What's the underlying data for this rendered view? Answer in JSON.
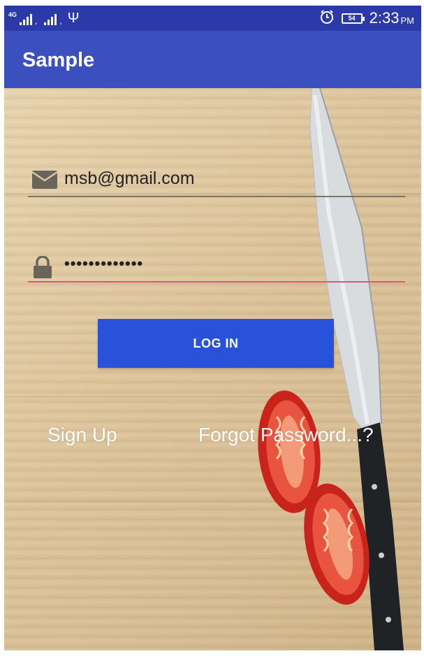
{
  "status_bar": {
    "network_type": "4G",
    "time": "2:33",
    "am_pm": "PM",
    "battery_level": "54",
    "icons": [
      "signal-icon",
      "signal-icon",
      "usb-icon",
      "alarm-icon",
      "battery-icon"
    ]
  },
  "app_bar": {
    "title": "Sample",
    "color": "#3c4fbe"
  },
  "login_form": {
    "email_value": "msb@gmail.com",
    "password_value": "•••••••••••••",
    "login_label": "LOG IN",
    "signup_label": "Sign Up",
    "forgot_label": "Forgot Password...?",
    "accent_color": "#2852d9",
    "focus_underline_color": "#e0567b",
    "email_icon": "email-icon",
    "password_icon": "lock-icon"
  }
}
